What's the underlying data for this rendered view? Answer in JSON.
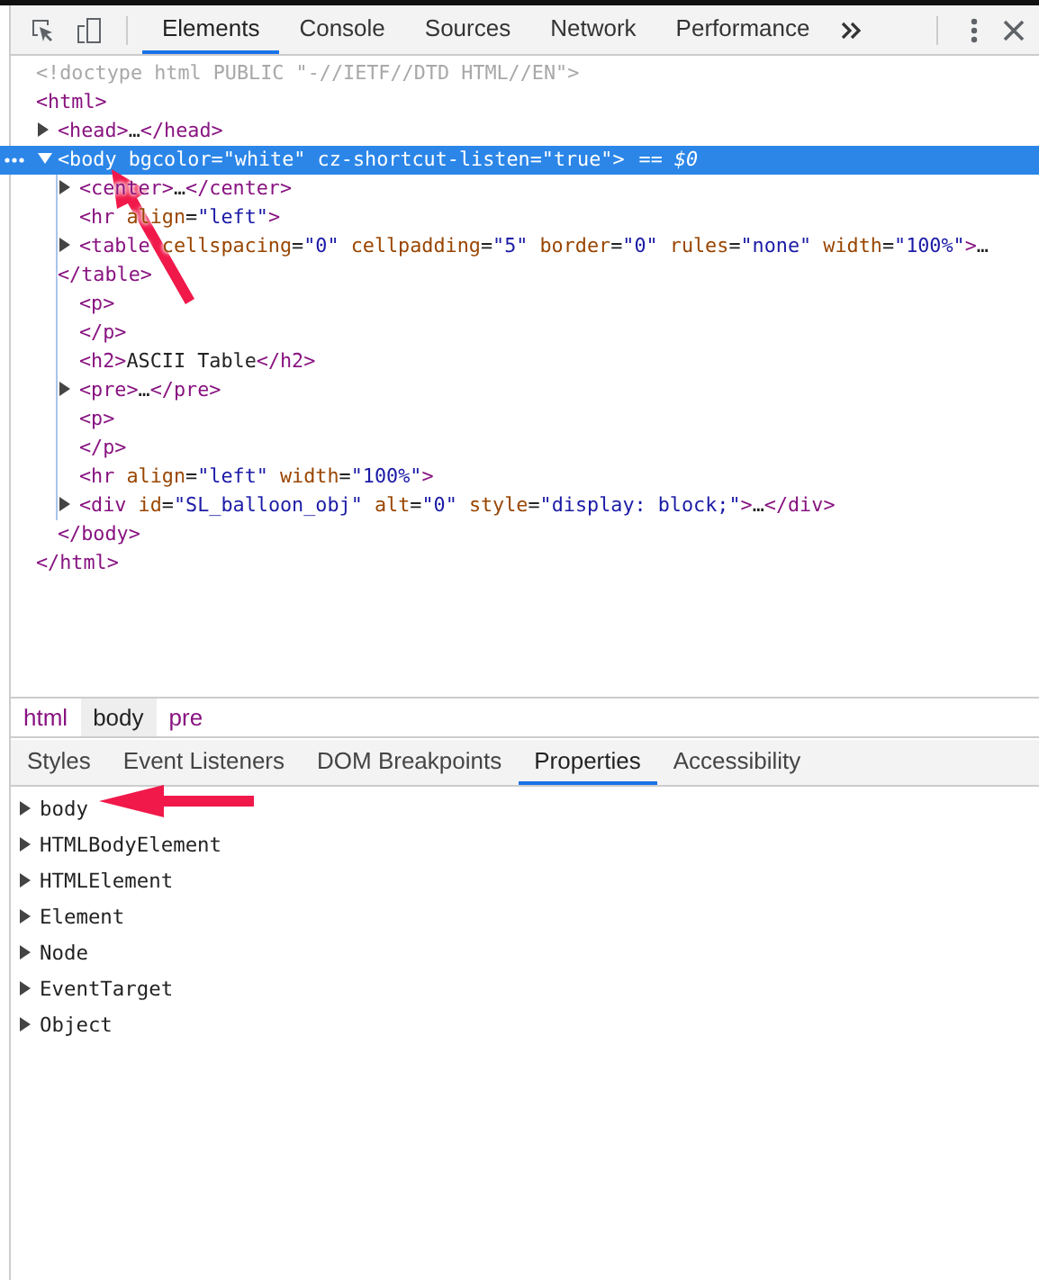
{
  "toolbar": {
    "tabs": [
      {
        "label": "Elements",
        "selected": true
      },
      {
        "label": "Console",
        "selected": false
      },
      {
        "label": "Sources",
        "selected": false
      },
      {
        "label": "Network",
        "selected": false
      },
      {
        "label": "Performance",
        "selected": false
      }
    ]
  },
  "dom_tree": [
    {
      "kind": "doctype",
      "text": "<!doctype html PUBLIC \"-//IETF//DTD HTML//EN\">",
      "selected": false
    },
    {
      "kind": "container",
      "text": "<html>",
      "closing": "</html>",
      "selected": false,
      "children": [
        {
          "kind": "toggle",
          "text": "<head>…</head>",
          "expanded": false,
          "selected": false
        },
        {
          "kind": "toggle",
          "text": "<body bgcolor=\"white\" cz-shortcut-listen=\"true\">",
          "badge": "== $0",
          "expanded": true,
          "selected": true,
          "closing": "</body>",
          "children": [
            {
              "kind": "toggle",
              "text": "<center>…</center>",
              "expanded": false,
              "selected": false
            },
            {
              "kind": "leaf",
              "text": "<hr align=\"left\">",
              "selected": false
            },
            {
              "kind": "toggle",
              "text": "<table cellspacing=\"0\" cellpadding=\"5\" border=\"0\" rules=\"none\" width=\"100%\">…",
              "continuation": "</table>",
              "expanded": false,
              "selected": false
            },
            {
              "kind": "leaf",
              "text": "<p>",
              "selected": false
            },
            {
              "kind": "leaf",
              "text": "</p>",
              "selected": false
            },
            {
              "kind": "leaf",
              "text": "<h2>ASCII Table</h2>",
              "selected": false
            },
            {
              "kind": "toggle",
              "text": "<pre>…</pre>",
              "expanded": false,
              "selected": false
            },
            {
              "kind": "leaf",
              "text": "<p>",
              "selected": false
            },
            {
              "kind": "leaf",
              "text": "</p>",
              "selected": false
            },
            {
              "kind": "leaf",
              "text": "<hr align=\"left\" width=\"100%\">",
              "selected": false
            },
            {
              "kind": "toggle",
              "text": "<div id=\"SL_balloon_obj\" alt=\"0\" style=\"display: block;\">…</div>",
              "expanded": false,
              "selected": false
            }
          ]
        }
      ]
    }
  ],
  "breadcrumbs": [
    {
      "label": "html",
      "selected": false
    },
    {
      "label": "body",
      "selected": true
    },
    {
      "label": "pre",
      "selected": false
    }
  ],
  "sidebar_tabs": [
    {
      "label": "Styles",
      "selected": false
    },
    {
      "label": "Event Listeners",
      "selected": false
    },
    {
      "label": "DOM Breakpoints",
      "selected": false
    },
    {
      "label": "Properties",
      "selected": true
    },
    {
      "label": "Accessibility",
      "selected": false
    }
  ],
  "properties": [
    {
      "label": "body",
      "expanded": false
    },
    {
      "label": "HTMLBodyElement",
      "expanded": false
    },
    {
      "label": "HTMLElement",
      "expanded": false
    },
    {
      "label": "Element",
      "expanded": false
    },
    {
      "label": "Node",
      "expanded": false
    },
    {
      "label": "EventTarget",
      "expanded": false
    },
    {
      "label": "Object",
      "expanded": false
    }
  ]
}
